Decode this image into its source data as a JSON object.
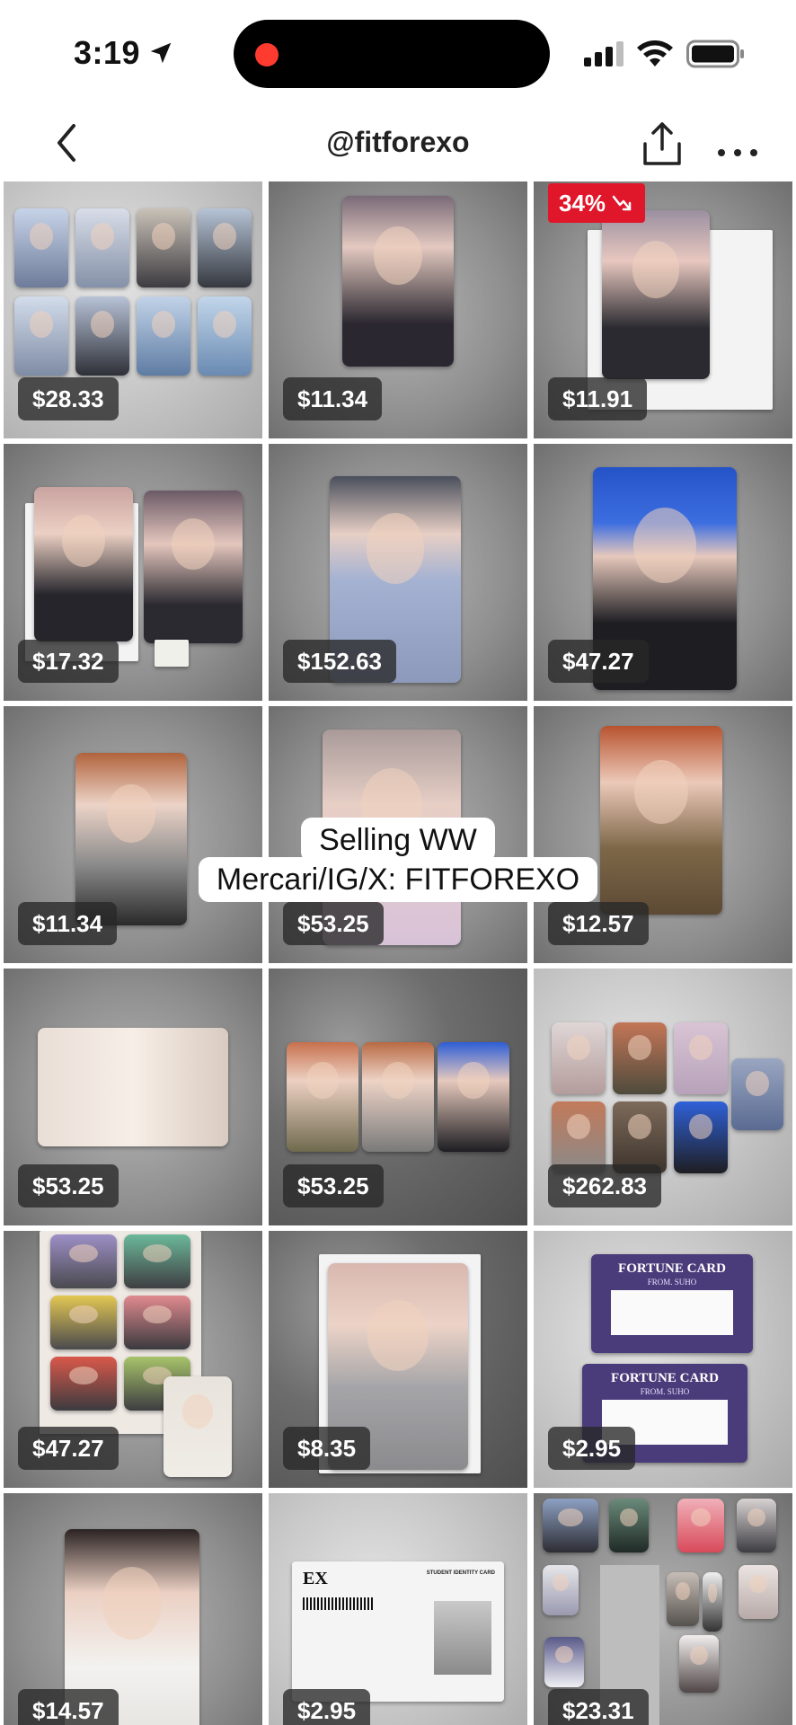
{
  "status_bar": {
    "time": "3:19",
    "icons": [
      "location-arrow-icon",
      "signal-bars-icon",
      "wifi-icon",
      "battery-icon"
    ],
    "recording_color": "#ff3b30"
  },
  "nav": {
    "title": "@fitforexo",
    "icons": [
      "chevron-left-icon",
      "share-icon",
      "more-horizontal-icon"
    ]
  },
  "overlay": {
    "line1": "Selling WW",
    "line2": "Mercari/IG/X: FITFOREXO"
  },
  "colors": {
    "discount_badge": "#e0162b",
    "price_badge_bg": "#282828"
  },
  "items": [
    {
      "price": "$28.33"
    },
    {
      "price": "$11.34"
    },
    {
      "price": "$11.91",
      "discount": "34%"
    },
    {
      "price": "$17.32"
    },
    {
      "price": "$152.63"
    },
    {
      "price": "$47.27"
    },
    {
      "price": "$11.34"
    },
    {
      "price": "$53.25"
    },
    {
      "price": "$12.57"
    },
    {
      "price": "$53.25"
    },
    {
      "price": "$53.25"
    },
    {
      "price": "$262.83"
    },
    {
      "price": "$47.27"
    },
    {
      "price": "$8.35"
    },
    {
      "price": "$2.95",
      "fortune_title": "FORTUNE CARD",
      "fortune_sub": "FROM. SUHO"
    },
    {
      "price": "$14.57"
    },
    {
      "price": "$2.95",
      "id_logo": "EX",
      "id_title": "STUDENT IDENTITY CARD"
    },
    {
      "price": "$23.31"
    }
  ]
}
